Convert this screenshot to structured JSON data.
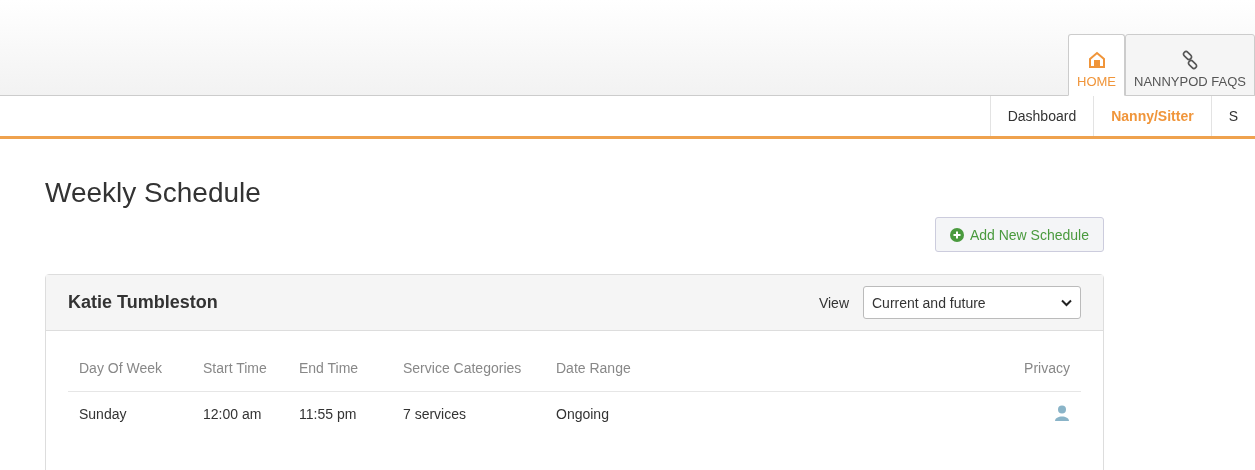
{
  "main_tabs": [
    {
      "label": "HOME",
      "selected": true
    },
    {
      "label": "NANNYPOD FAQS",
      "selected": false
    }
  ],
  "sub_nav": [
    {
      "label": "Dashboard",
      "selected": false
    },
    {
      "label": "Nanny/Sitter",
      "selected": true
    },
    {
      "label": "S",
      "selected": false
    }
  ],
  "page_title": "Weekly Schedule",
  "add_button": "Add New Schedule",
  "panel": {
    "title": "Katie Tumbleston",
    "view_label": "View",
    "view_value": "Current and future",
    "columns": [
      "Day Of Week",
      "Start Time",
      "End Time",
      "Service Categories",
      "Date Range",
      "Privacy"
    ],
    "rows": [
      {
        "cells": [
          "Sunday",
          "12:00 am",
          "11:55 pm",
          "7 services",
          "Ongoing"
        ]
      }
    ]
  }
}
